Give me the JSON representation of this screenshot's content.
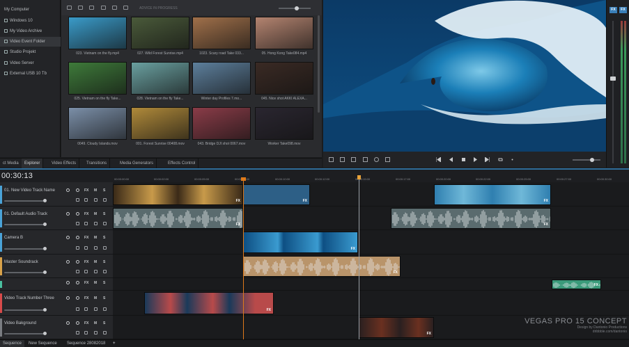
{
  "explorer": {
    "items": [
      {
        "label": "My Computer"
      },
      {
        "label": "Windows 10"
      },
      {
        "label": "My Video Archive"
      },
      {
        "label": "Video Event Folder"
      },
      {
        "label": "Studio Projekt"
      },
      {
        "label": "Video Server"
      },
      {
        "label": "External USB 10 Tb"
      }
    ]
  },
  "browser": {
    "toolbar_label": "ADVICE IN PROGRESS",
    "thumbnails": [
      {
        "caption": "023. Vietnam on the fly.mp4",
        "color": "#3a9bc9"
      },
      {
        "caption": "027. Wild Forest Sunrise.mp4",
        "color": "#4a5a3a"
      },
      {
        "caption": "1023. Scary road Take 033...",
        "color": "#a0704a"
      },
      {
        "caption": "05. Hong Kong Take084.mp4",
        "color": "#b48470"
      },
      {
        "caption": "025. Vietnam on the fly Take...",
        "color": "#3e7a3a"
      },
      {
        "caption": "028. Vietnam on the fly Take...",
        "color": "#6aa0a0"
      },
      {
        "caption": "Winter day Profiles 7.mo...",
        "color": "#5d7f9c"
      },
      {
        "caption": "045. Nice shot AKKI ALEXA...",
        "color": "#3a2a24"
      },
      {
        "caption": "0049. Cloudy Islands.mov",
        "color": "#7b8fa8"
      },
      {
        "caption": "001. Forest Sunrise 00408.mov",
        "color": "#b08a3a"
      },
      {
        "caption": "043. Bridge DJI shot 0067.mov",
        "color": "#8a3c48"
      },
      {
        "caption": "Worker Take098.mov",
        "color": "#2a2630"
      }
    ]
  },
  "tabs": [
    {
      "label": "ct Media"
    },
    {
      "label": "Explorer"
    },
    {
      "label": "Video Effects"
    },
    {
      "label": "Transitions"
    },
    {
      "label": "Media Generators"
    },
    {
      "label": "Effects Control"
    }
  ],
  "meters": {
    "btn1": "FX",
    "btn2": "FX"
  },
  "timeline": {
    "timecode": "00:30:13",
    "ruler_ticks": [
      "00:00:00:00",
      "00:00:02:00",
      "00:00:05:00",
      "00:00:07:00",
      "00:00:10:00",
      "00:00:12:00",
      "00:00:15:00",
      "00:00:17:00",
      "00:00:20:00",
      "00:00:22:00",
      "00:00:25:00",
      "00:00:27:00",
      "00:00:30:00"
    ],
    "tracks": [
      {
        "name": "01. New Video Track Name",
        "color": "#4aa3d8"
      },
      {
        "name": "01. Default Audio Track",
        "color": "#4aa3d8"
      },
      {
        "name": "Camera B",
        "color": "#4aa3d8"
      },
      {
        "name": "Master Soundrack",
        "color": "#d8a24a"
      },
      {
        "name": "",
        "color": "#4ac0a0"
      },
      {
        "name": "Video Track Number Three",
        "color": "#d84a4a"
      },
      {
        "name": "Video Bakground",
        "color": "#7a7d82"
      }
    ],
    "track_buttons": {
      "fx": "FX",
      "m": "M",
      "s": "S"
    },
    "clip_fx": "FX"
  },
  "sequences": [
    {
      "label": "Sequence"
    },
    {
      "label": "New Sequence"
    },
    {
      "label": "Sequence 28082018"
    },
    {
      "label": "+"
    }
  ],
  "watermark": {
    "title": "VEGAS PRO 15 CONCEPT",
    "sub1": "Design by Dantonio Productions",
    "sub2": "dribbble.com/dantonio"
  }
}
